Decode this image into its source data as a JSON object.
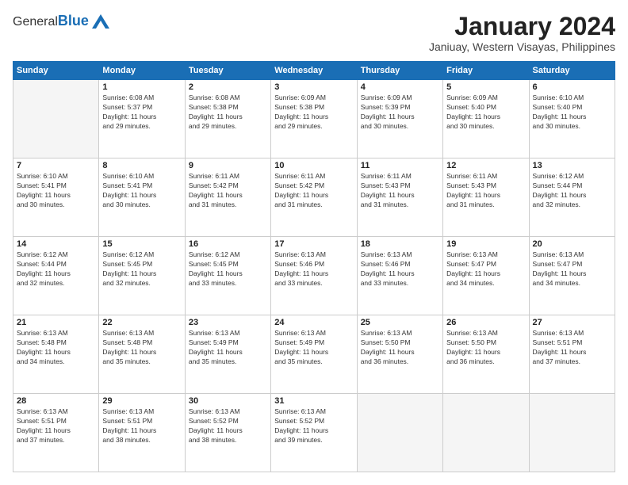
{
  "header": {
    "logo_general": "General",
    "logo_blue": "Blue",
    "month_title": "January 2024",
    "subtitle": "Janiuay, Western Visayas, Philippines"
  },
  "days_of_week": [
    "Sunday",
    "Monday",
    "Tuesday",
    "Wednesday",
    "Thursday",
    "Friday",
    "Saturday"
  ],
  "weeks": [
    [
      {
        "day": "",
        "empty": true
      },
      {
        "day": "1",
        "sunrise": "6:08 AM",
        "sunset": "5:37 PM",
        "daylight": "11 hours and 29 minutes."
      },
      {
        "day": "2",
        "sunrise": "6:08 AM",
        "sunset": "5:38 PM",
        "daylight": "11 hours and 29 minutes."
      },
      {
        "day": "3",
        "sunrise": "6:09 AM",
        "sunset": "5:38 PM",
        "daylight": "11 hours and 29 minutes."
      },
      {
        "day": "4",
        "sunrise": "6:09 AM",
        "sunset": "5:39 PM",
        "daylight": "11 hours and 30 minutes."
      },
      {
        "day": "5",
        "sunrise": "6:09 AM",
        "sunset": "5:40 PM",
        "daylight": "11 hours and 30 minutes."
      },
      {
        "day": "6",
        "sunrise": "6:10 AM",
        "sunset": "5:40 PM",
        "daylight": "11 hours and 30 minutes."
      }
    ],
    [
      {
        "day": "7",
        "sunrise": "6:10 AM",
        "sunset": "5:41 PM",
        "daylight": "11 hours and 30 minutes."
      },
      {
        "day": "8",
        "sunrise": "6:10 AM",
        "sunset": "5:41 PM",
        "daylight": "11 hours and 30 minutes."
      },
      {
        "day": "9",
        "sunrise": "6:11 AM",
        "sunset": "5:42 PM",
        "daylight": "11 hours and 31 minutes."
      },
      {
        "day": "10",
        "sunrise": "6:11 AM",
        "sunset": "5:42 PM",
        "daylight": "11 hours and 31 minutes."
      },
      {
        "day": "11",
        "sunrise": "6:11 AM",
        "sunset": "5:43 PM",
        "daylight": "11 hours and 31 minutes."
      },
      {
        "day": "12",
        "sunrise": "6:11 AM",
        "sunset": "5:43 PM",
        "daylight": "11 hours and 31 minutes."
      },
      {
        "day": "13",
        "sunrise": "6:12 AM",
        "sunset": "5:44 PM",
        "daylight": "11 hours and 32 minutes."
      }
    ],
    [
      {
        "day": "14",
        "sunrise": "6:12 AM",
        "sunset": "5:44 PM",
        "daylight": "11 hours and 32 minutes."
      },
      {
        "day": "15",
        "sunrise": "6:12 AM",
        "sunset": "5:45 PM",
        "daylight": "11 hours and 32 minutes."
      },
      {
        "day": "16",
        "sunrise": "6:12 AM",
        "sunset": "5:45 PM",
        "daylight": "11 hours and 33 minutes."
      },
      {
        "day": "17",
        "sunrise": "6:13 AM",
        "sunset": "5:46 PM",
        "daylight": "11 hours and 33 minutes."
      },
      {
        "day": "18",
        "sunrise": "6:13 AM",
        "sunset": "5:46 PM",
        "daylight": "11 hours and 33 minutes."
      },
      {
        "day": "19",
        "sunrise": "6:13 AM",
        "sunset": "5:47 PM",
        "daylight": "11 hours and 34 minutes."
      },
      {
        "day": "20",
        "sunrise": "6:13 AM",
        "sunset": "5:47 PM",
        "daylight": "11 hours and 34 minutes."
      }
    ],
    [
      {
        "day": "21",
        "sunrise": "6:13 AM",
        "sunset": "5:48 PM",
        "daylight": "11 hours and 34 minutes."
      },
      {
        "day": "22",
        "sunrise": "6:13 AM",
        "sunset": "5:48 PM",
        "daylight": "11 hours and 35 minutes."
      },
      {
        "day": "23",
        "sunrise": "6:13 AM",
        "sunset": "5:49 PM",
        "daylight": "11 hours and 35 minutes."
      },
      {
        "day": "24",
        "sunrise": "6:13 AM",
        "sunset": "5:49 PM",
        "daylight": "11 hours and 35 minutes."
      },
      {
        "day": "25",
        "sunrise": "6:13 AM",
        "sunset": "5:50 PM",
        "daylight": "11 hours and 36 minutes."
      },
      {
        "day": "26",
        "sunrise": "6:13 AM",
        "sunset": "5:50 PM",
        "daylight": "11 hours and 36 minutes."
      },
      {
        "day": "27",
        "sunrise": "6:13 AM",
        "sunset": "5:51 PM",
        "daylight": "11 hours and 37 minutes."
      }
    ],
    [
      {
        "day": "28",
        "sunrise": "6:13 AM",
        "sunset": "5:51 PM",
        "daylight": "11 hours and 37 minutes."
      },
      {
        "day": "29",
        "sunrise": "6:13 AM",
        "sunset": "5:51 PM",
        "daylight": "11 hours and 38 minutes."
      },
      {
        "day": "30",
        "sunrise": "6:13 AM",
        "sunset": "5:52 PM",
        "daylight": "11 hours and 38 minutes."
      },
      {
        "day": "31",
        "sunrise": "6:13 AM",
        "sunset": "5:52 PM",
        "daylight": "11 hours and 39 minutes."
      },
      {
        "day": "",
        "empty": true
      },
      {
        "day": "",
        "empty": true
      },
      {
        "day": "",
        "empty": true
      }
    ]
  ]
}
